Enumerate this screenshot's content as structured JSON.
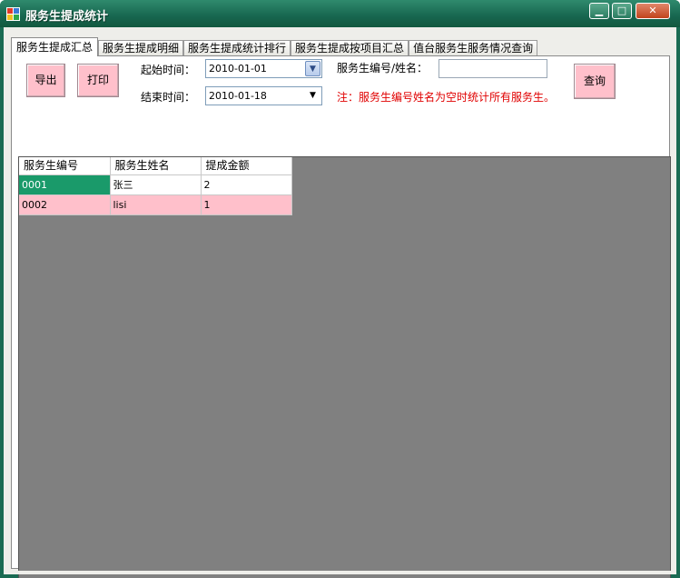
{
  "window": {
    "title": "服务生提成统计",
    "minimize_label": "▁",
    "maximize_label": "□",
    "close_label": "✕"
  },
  "tabs": [
    {
      "label": "服务生提成汇总",
      "active": true
    },
    {
      "label": "服务生提成明细",
      "active": false
    },
    {
      "label": "服务生提成统计排行",
      "active": false
    },
    {
      "label": "服务生提成按项目汇总",
      "active": false
    },
    {
      "label": "值台服务生服务情况查询",
      "active": false
    }
  ],
  "toolbar": {
    "export_label": "导出",
    "print_label": "打印",
    "query_label": "查询"
  },
  "filters": {
    "start_label": "起始时间：",
    "start_value": "2010-01-01",
    "end_label": "结束时间：",
    "end_value": "2010-01-18",
    "waiter_label": "服务生编号/姓名：",
    "waiter_value": "",
    "note": "注：服务生编号姓名为空时统计所有服务生。"
  },
  "table": {
    "columns": [
      "服务生编号",
      "服务生姓名",
      "提成金额"
    ],
    "rows": [
      [
        "0001",
        "张三",
        "2"
      ],
      [
        "0002",
        "lisi",
        "1"
      ]
    ]
  },
  "colors": {
    "accent_pink": "#ffc0cb",
    "selection_green": "#1a9a6a",
    "note_red": "#e00000",
    "grid_background": "#808080"
  }
}
